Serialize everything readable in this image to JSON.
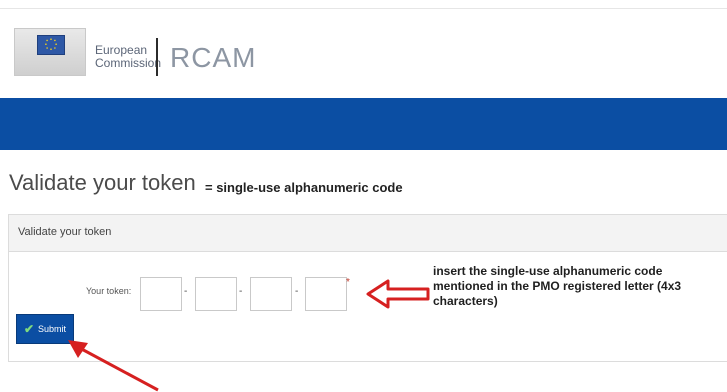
{
  "header": {
    "org_line1": "European",
    "org_line2": "Commission",
    "app_name": "RCAM",
    "flag_icon": "eu-flag-icon"
  },
  "page": {
    "title": "Validate your token",
    "annotation_note": "= single-use alphanumeric code"
  },
  "panel": {
    "heading": "Validate your token",
    "token_label": "Your token:",
    "token_separator": "-",
    "required_marker": "*",
    "submit_label": "Submit",
    "submit_icon": "checkmark-icon"
  },
  "annotations": {
    "instruction_text": "insert the single-use alphanumeric code mentioned in the PMO registered letter (4x3 characters)",
    "arrow_color": "#d62020"
  },
  "colors": {
    "brand_blue": "#0b4ea3",
    "panel_header_bg": "#f3f3f3"
  }
}
